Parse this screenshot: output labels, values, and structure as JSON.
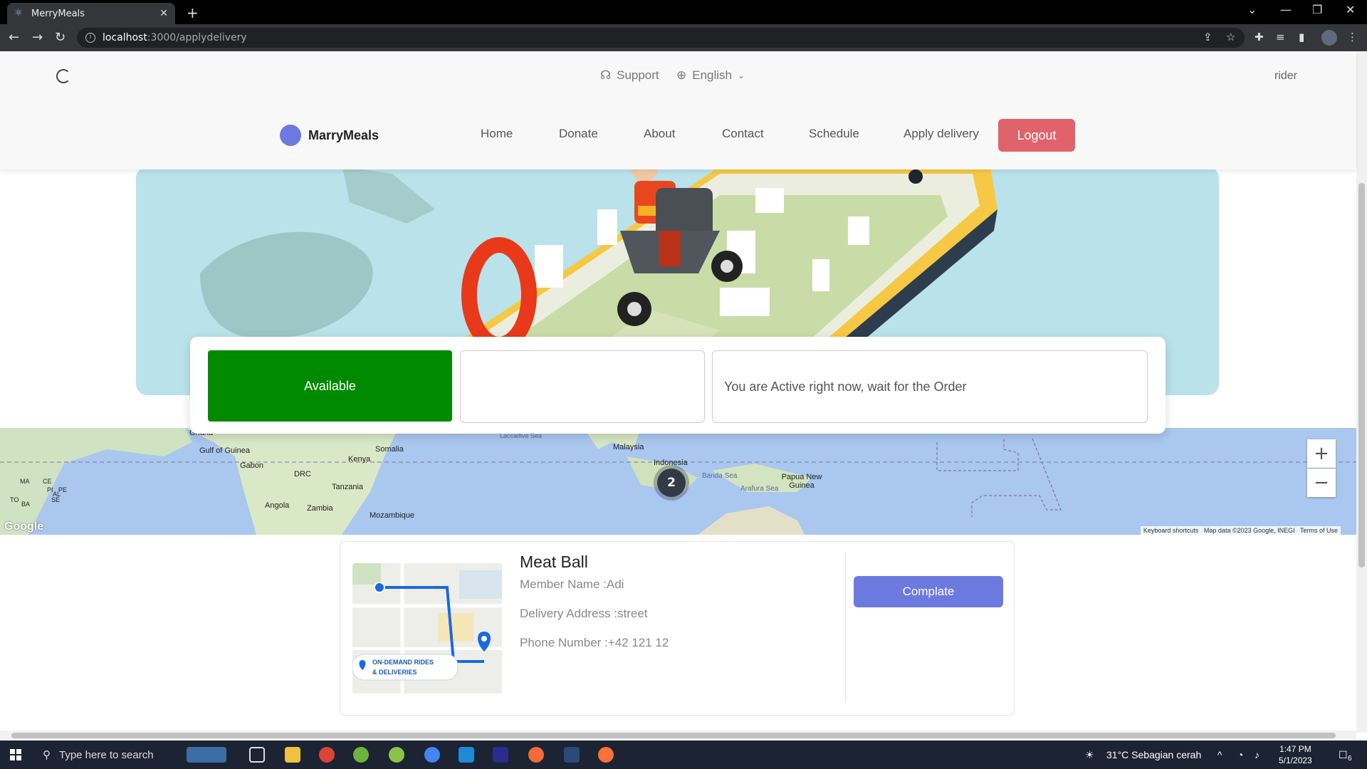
{
  "browser": {
    "tab_title": "MerryMeals",
    "url_host": "localhost",
    "url_path": ":3000/applydelivery"
  },
  "header": {
    "support_label": "Support",
    "language_label": "English",
    "user_label": "rider",
    "brand": "MarryMeals",
    "nav": [
      "Home",
      "Donate",
      "About",
      "Contact",
      "Schedule",
      "Apply delivery"
    ],
    "logout_label": "Logout"
  },
  "status": {
    "available_label": "Available",
    "message": "You are Active right now, wait for the Order"
  },
  "map": {
    "labels": [
      "Gulf of Guinea",
      "Gabon",
      "DRC",
      "Kenya",
      "Somalia",
      "Tanzania",
      "Angola",
      "Zambia",
      "Mozambique",
      "Laccadive Sea",
      "Malaysia",
      "Indonesia",
      "Banda Sea",
      "Arafura Sea",
      "Papua New Guinea",
      "Ghana",
      "MA",
      "CE",
      "PI",
      "PE",
      "TO",
      "BA",
      "AL",
      "SE"
    ],
    "cluster_count": "2",
    "google_logo": "Google",
    "footer_keyboard": "Keyboard shortcuts",
    "footer_data": "Map data ©2023 Google, INEGI",
    "footer_terms": "Terms of Use"
  },
  "order": {
    "title": "Meat Ball",
    "member": "Member Name :Adi",
    "address": "Delivery Address :street",
    "phone": "Phone Number :+42 121 12",
    "image_caption_1": "ON-DEMAND RIDES",
    "image_caption_2": "& DELIVERIES",
    "complete_label": "Complate"
  },
  "taskbar": {
    "search_placeholder": "Type here to search",
    "weather": "31°C  Sebagian cerah",
    "time": "1:47 PM",
    "date": "5/1/2023",
    "notifications": "6"
  }
}
